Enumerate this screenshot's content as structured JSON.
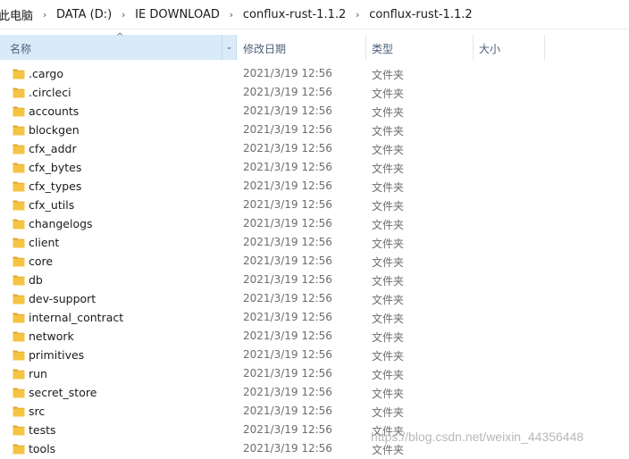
{
  "breadcrumb": [
    "此电脑",
    "DATA (D:)",
    "IE DOWNLOAD",
    "conflux-rust-1.1.2",
    "conflux-rust-1.1.2"
  ],
  "columns": {
    "name": "名称",
    "date": "修改日期",
    "type": "类型",
    "size": "大小"
  },
  "files": [
    {
      "name": ".cargo",
      "date": "2021/3/19 12:56",
      "type": "文件夹"
    },
    {
      "name": ".circleci",
      "date": "2021/3/19 12:56",
      "type": "文件夹"
    },
    {
      "name": "accounts",
      "date": "2021/3/19 12:56",
      "type": "文件夹"
    },
    {
      "name": "blockgen",
      "date": "2021/3/19 12:56",
      "type": "文件夹"
    },
    {
      "name": "cfx_addr",
      "date": "2021/3/19 12:56",
      "type": "文件夹"
    },
    {
      "name": "cfx_bytes",
      "date": "2021/3/19 12:56",
      "type": "文件夹"
    },
    {
      "name": "cfx_types",
      "date": "2021/3/19 12:56",
      "type": "文件夹"
    },
    {
      "name": "cfx_utils",
      "date": "2021/3/19 12:56",
      "type": "文件夹"
    },
    {
      "name": "changelogs",
      "date": "2021/3/19 12:56",
      "type": "文件夹"
    },
    {
      "name": "client",
      "date": "2021/3/19 12:56",
      "type": "文件夹"
    },
    {
      "name": "core",
      "date": "2021/3/19 12:56",
      "type": "文件夹"
    },
    {
      "name": "db",
      "date": "2021/3/19 12:56",
      "type": "文件夹"
    },
    {
      "name": "dev-support",
      "date": "2021/3/19 12:56",
      "type": "文件夹"
    },
    {
      "name": "internal_contract",
      "date": "2021/3/19 12:56",
      "type": "文件夹"
    },
    {
      "name": "network",
      "date": "2021/3/19 12:56",
      "type": "文件夹"
    },
    {
      "name": "primitives",
      "date": "2021/3/19 12:56",
      "type": "文件夹"
    },
    {
      "name": "run",
      "date": "2021/3/19 12:56",
      "type": "文件夹"
    },
    {
      "name": "secret_store",
      "date": "2021/3/19 12:56",
      "type": "文件夹"
    },
    {
      "name": "src",
      "date": "2021/3/19 12:56",
      "type": "文件夹"
    },
    {
      "name": "tests",
      "date": "2021/3/19 12:56",
      "type": "文件夹"
    },
    {
      "name": "tools",
      "date": "2021/3/19 12:56",
      "type": "文件夹"
    }
  ],
  "watermark": "https://blog.csdn.net/weixin_44356448",
  "colors": {
    "header_selected_bg": "#d9ebf9",
    "folder": "#f5c443",
    "folder_dark": "#e0a52a",
    "meta_text": "#6d6d6d"
  },
  "icons": {
    "folder": "folder-icon",
    "separator": "chevron-right-icon",
    "sort": "sort-up-icon",
    "dropdown": "chevron-down-icon"
  }
}
